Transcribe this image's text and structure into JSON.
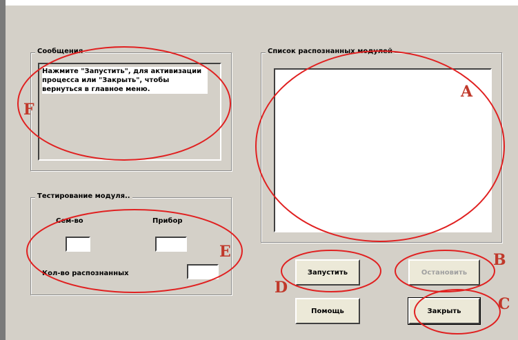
{
  "messages_group": {
    "title": "Сообщения",
    "text": "Нажмите \"Запустить\", для активизации процесса или \"Закрыть\", чтобы вернуться в главное меню."
  },
  "modules_group": {
    "title": "Список распознанных  модулей"
  },
  "testing_group": {
    "title": "Тестирование модуля..",
    "count_label": "Сем-во",
    "count_value": "",
    "device_label": "Прибор",
    "device_value": "",
    "recognized_label": "Кол-во распознанных",
    "recognized_value": ""
  },
  "buttons": {
    "start": "Запустить",
    "stop": "Остановить",
    "help": "Помощь",
    "close": "Закрыть"
  },
  "annotations": {
    "a": "A",
    "b": "B",
    "c": "C",
    "d": "D",
    "e": "E",
    "f": "F"
  },
  "colors": {
    "annotation": "#c0392b",
    "dialog_bg": "#d4d0c8"
  }
}
